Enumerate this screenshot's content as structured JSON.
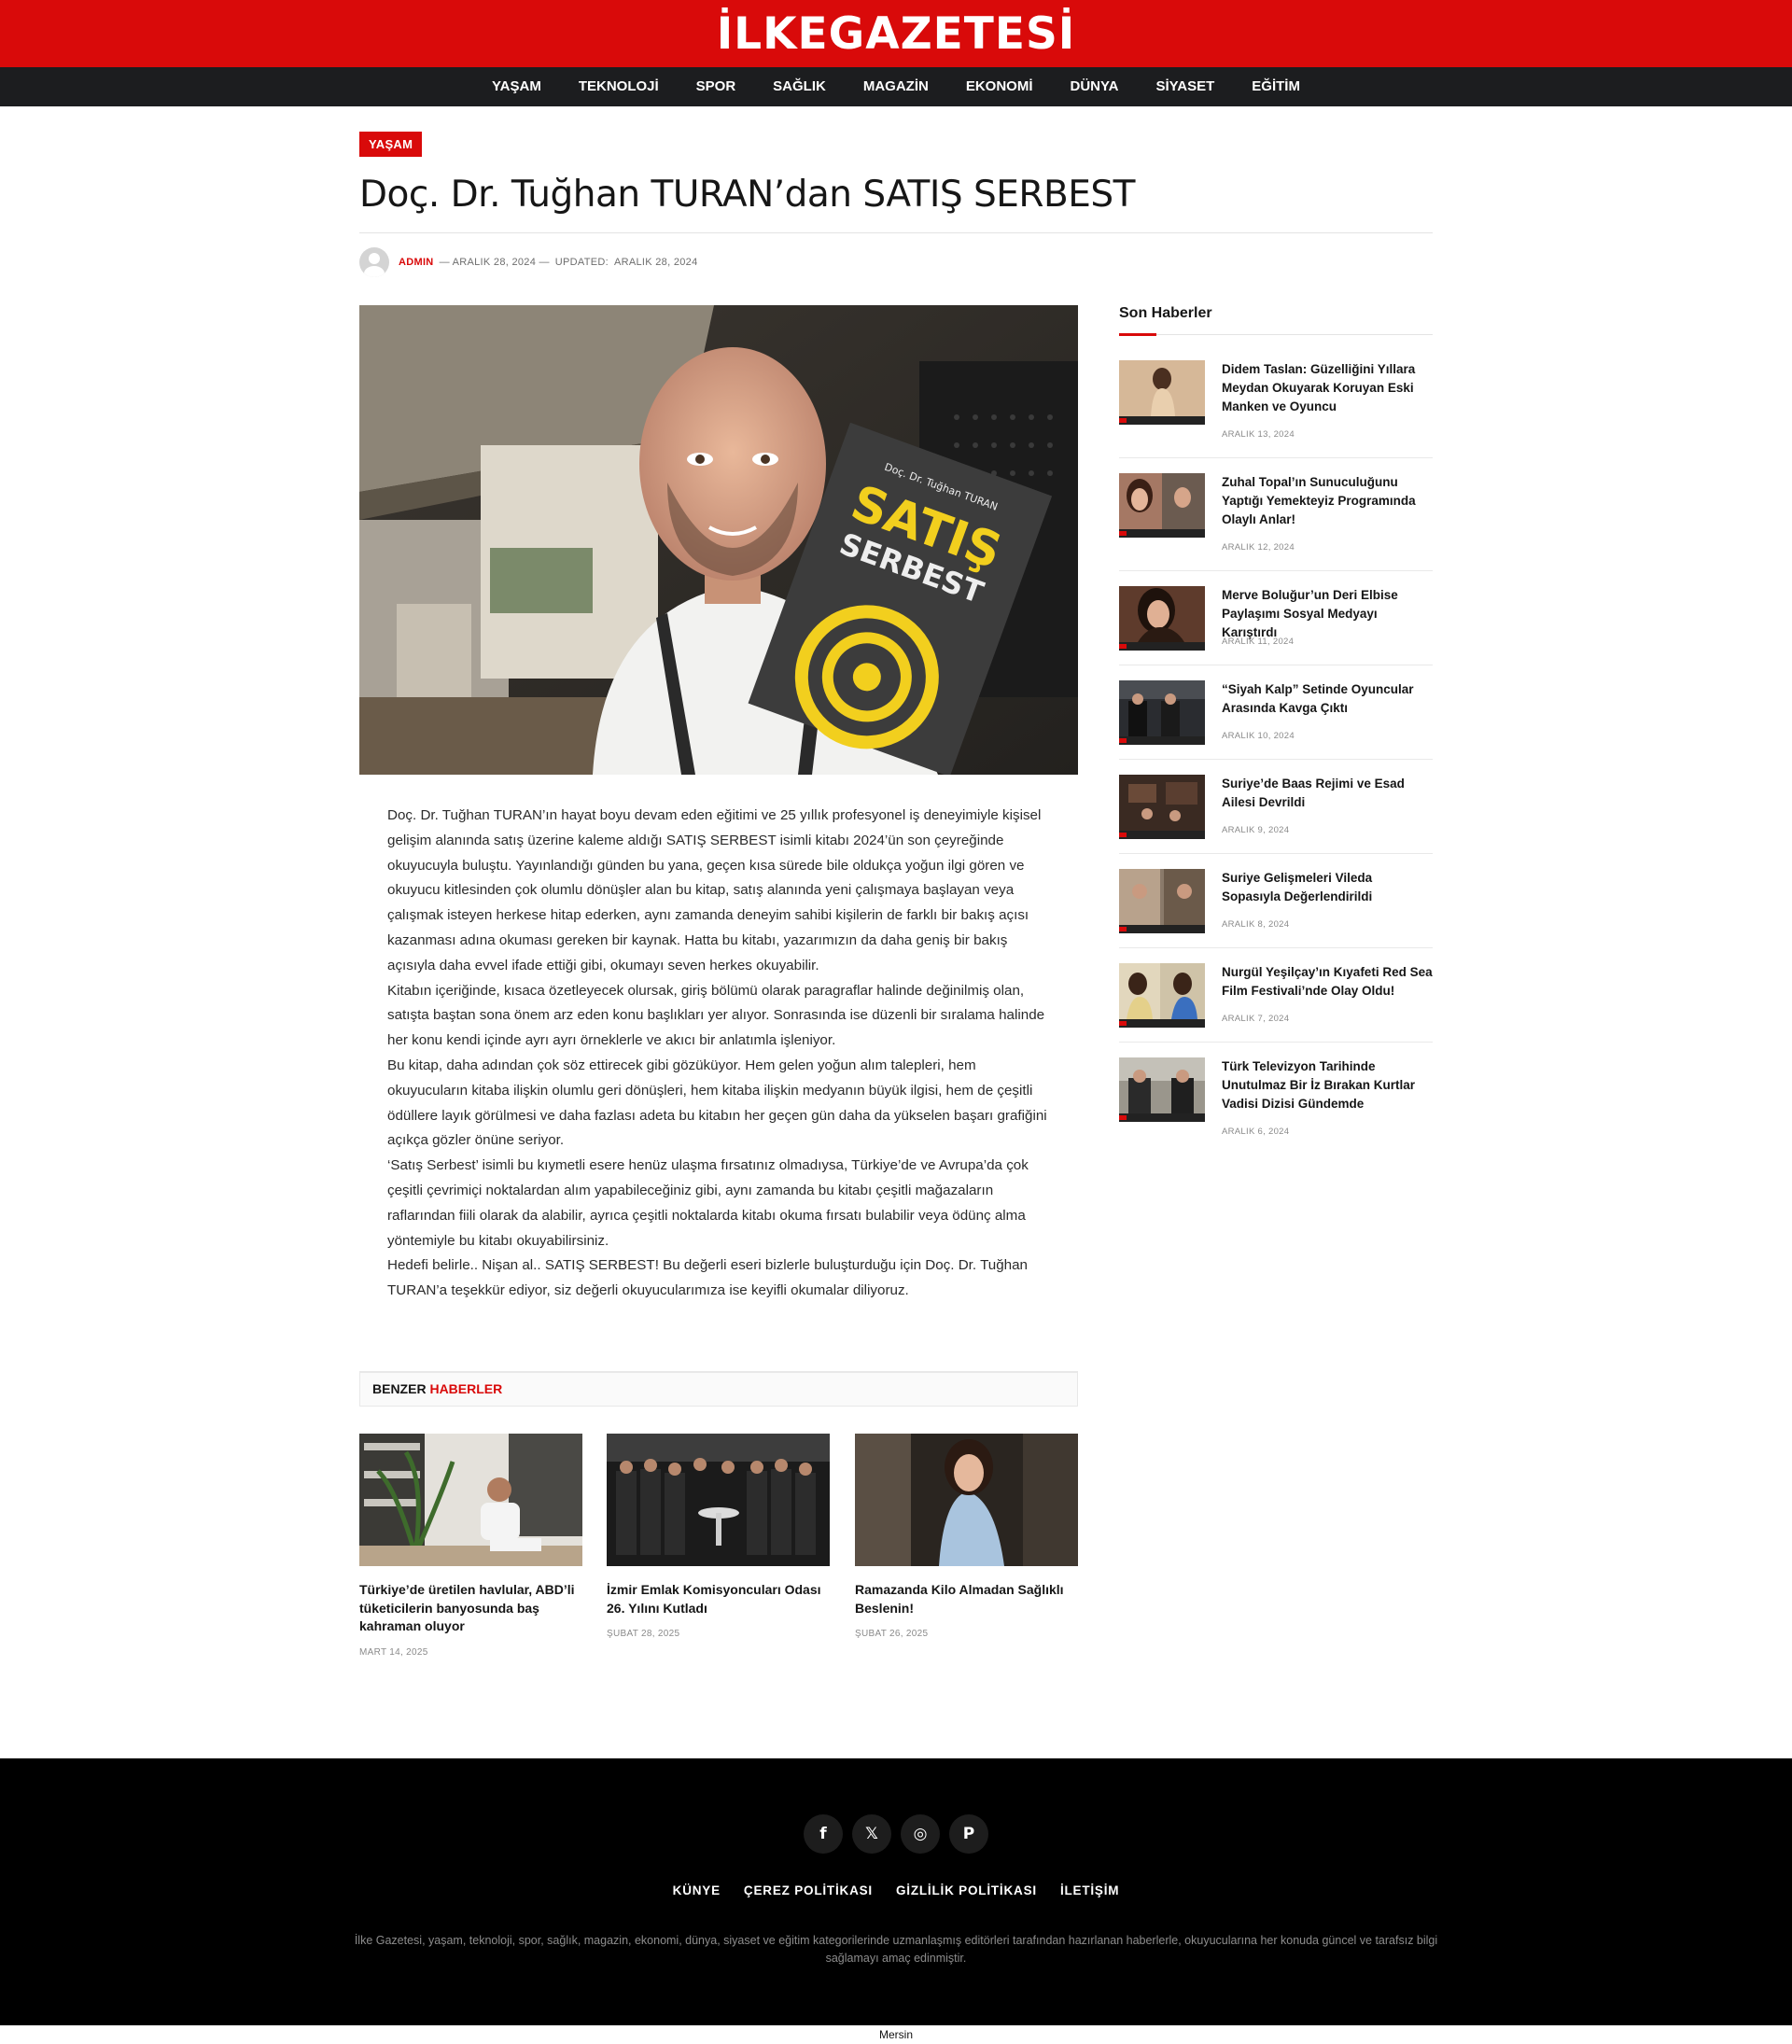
{
  "site": {
    "logo": "İLKEGAZETESİ"
  },
  "nav": {
    "items": [
      "YAŞAM",
      "TEKNOLOJİ",
      "SPOR",
      "SAĞLIK",
      "MAGAZİN",
      "EKONOMİ",
      "DÜNYA",
      "SİYASET",
      "EĞİTİM"
    ]
  },
  "article": {
    "category": "YAŞAM",
    "title": "Doç. Dr. Tuğhan TURAN’dan SATIŞ SERBEST",
    "author": "ADMIN",
    "date": "— ARALIK 28, 2024 —",
    "updated_label": "UPDATED:",
    "updated_date": "ARALIK 28, 2024",
    "book_cover": {
      "author": "Doç. Dr. Tuğhan TURAN",
      "title_line1": "SATIŞ",
      "title_line2": "SERBEST"
    },
    "paragraphs": [
      "Doç. Dr. Tuğhan TURAN’ın hayat boyu devam eden eğitimi ve 25 yıllık profesyonel iş deneyimiyle kişisel gelişim alanında satış üzerine kaleme aldığı SATIŞ SERBEST isimli kitabı 2024’ün son çeyreğinde okuyucuyla buluştu. Yayınlandığı günden bu yana, geçen kısa sürede bile oldukça yoğun ilgi gören ve okuyucu kitlesinden çok olumlu dönüşler alan bu kitap, satış alanında yeni çalışmaya başlayan veya çalışmak isteyen herkese hitap ederken, aynı zamanda deneyim sahibi kişilerin de farklı bir bakış açısı kazanması adına okuması gereken bir kaynak. Hatta bu kitabı, yazarımızın da daha geniş bir bakış açısıyla daha evvel ifade ettiği gibi, okumayı seven herkes okuyabilir.",
      "Kitabın içeriğinde, kısaca özetleyecek olursak, giriş bölümü olarak paragraflar halinde değinilmiş olan, satışta baştan sona önem arz eden konu başlıkları yer alıyor. Sonrasında ise düzenli bir sıralama halinde her konu kendi içinde ayrı ayrı örneklerle ve akıcı bir anlatımla işleniyor.",
      "Bu kitap, daha adından çok söz ettirecek gibi gözüküyor. Hem gelen yoğun alım talepleri, hem okuyucuların kitaba ilişkin olumlu geri dönüşleri, hem kitaba ilişkin medyanın büyük ilgisi, hem de çeşitli ödüllere layık görülmesi ve daha fazlası adeta bu kitabın her geçen gün daha da yükselen başarı grafiğini açıkça gözler önüne seriyor.",
      "‘Satış Serbest’ isimli bu kıymetli esere henüz ulaşma fırsatınız olmadıysa, Türkiye’de ve Avrupa’da çok çeşitli çevrimiçi noktalardan alım yapabileceğiniz gibi, aynı zamanda bu kitabı çeşitli mağazaların raflarından fiili olarak da alabilir, ayrıca çeşitli noktalarda kitabı okuma fırsatı bulabilir veya ödünç alma yöntemiyle bu kitabı okuyabilirsiniz.",
      "Hedefi belirle.. Nişan al.. SATIŞ SERBEST! Bu değerli eseri bizlerle buluşturduğu için Doç. Dr. Tuğhan TURAN’a teşekkür ediyor, siz değerli okuyucularımıza ise keyifli okumalar diliyoruz."
    ]
  },
  "related": {
    "heading_prefix": "BENZER",
    "heading_accent": "HABERLER",
    "items": [
      {
        "title": "Türkiye’de üretilen havlular, ABD’li tüketicilerin banyosunda baş kahraman oluyor",
        "date": "MART 14, 2025"
      },
      {
        "title": "İzmir Emlak Komisyoncuları Odası 26. Yılını Kutladı",
        "date": "ŞUBAT 28, 2025"
      },
      {
        "title": "Ramazanda Kilo Almadan Sağlıklı Beslenin!",
        "date": "ŞUBAT 26, 2025"
      }
    ]
  },
  "sidebar": {
    "heading": "Son Haberler",
    "items": [
      {
        "title": "Didem Taslan: Güzelliğini Yıllara Meydan Okuyarak Koruyan Eski Manken ve Oyuncu",
        "date": "ARALIK 13, 2024"
      },
      {
        "title": "Zuhal Topal’ın Sunuculuğunu Yaptığı Yemekteyiz Programında Olaylı Anlar!",
        "date": "ARALIK 12, 2024"
      },
      {
        "title": "Merve Boluğur’un Deri Elbise Paylaşımı Sosyal Medyayı Karıştırdı",
        "date": "ARALIK 11, 2024"
      },
      {
        "title": "“Siyah Kalp” Setinde Oyuncular Arasında Kavga Çıktı",
        "date": "ARALIK 10, 2024"
      },
      {
        "title": "Suriye’de Baas Rejimi ve Esad Ailesi Devrildi",
        "date": "ARALIK 9, 2024"
      },
      {
        "title": "Suriye Gelişmeleri Vileda Sopasıyla Değerlendirildi",
        "date": "ARALIK 8, 2024"
      },
      {
        "title": "Nurgül Yeşilçay’ın Kıyafeti Red Sea Film Festivali’nde Olay Oldu!",
        "date": "ARALIK 7, 2024"
      },
      {
        "title": "Türk Televizyon Tarihinde Unutulmaz Bir İz Bırakan Kurtlar Vadisi Dizisi Gündemde",
        "date": "ARALIK 6, 2024"
      }
    ]
  },
  "footer": {
    "social": [
      {
        "icon": "facebook-icon",
        "glyph": "f"
      },
      {
        "icon": "x-icon",
        "glyph": "𝕏"
      },
      {
        "icon": "instagram-icon",
        "glyph": "◎"
      },
      {
        "icon": "pinterest-icon",
        "glyph": "P"
      }
    ],
    "links": [
      "KÜNYE",
      "ÇEREZ POLİTİKASI",
      "GİZLİLİK POLİTİKASI",
      "İLETİŞİM"
    ],
    "description": "İlke Gazetesi, yaşam, teknoloji, spor, sağlık, magazin, ekonomi, dünya, siyaset ve eğitim kategorilerinde uzmanlaşmış editörleri tarafından hazırlanan haberlerle, okuyucularına her konuda güncel ve tarafsız bilgi sağlamayı amaç edinmiştir.",
    "bottom_text": "Mersin"
  },
  "colors": {
    "brand": "#d90a0a",
    "nav_bg": "#1c1d1f",
    "footer_bg": "#000000"
  }
}
